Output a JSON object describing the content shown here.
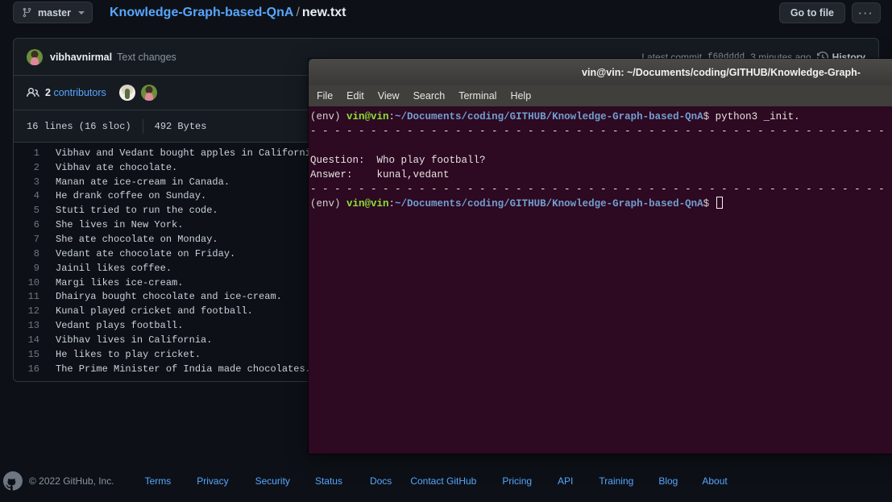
{
  "colors": {
    "page_bg": "#0d1117",
    "card_bg": "#161b22",
    "border": "#30363d",
    "link": "#58a6ff",
    "terminal_bg": "#2d0922",
    "terminal_green": "#8ae234",
    "terminal_blue": "#729fcf"
  },
  "header": {
    "branch_label": "master",
    "branch_icon": "git-branch-icon",
    "caret_icon": "chevron-down-icon",
    "repo_name": "Knowledge-Graph-based-QnA",
    "path_separator": "/",
    "file_name": "new.txt",
    "go_to_file_label": "Go to file",
    "more_options_label": "···"
  },
  "commit": {
    "author_avatar": "avatar-vibhavnirmal",
    "author": "vibhavnirmal",
    "message": "Text changes",
    "latest_commit_label": "Latest commit",
    "sha": "f60dddd",
    "time_ago": "3 minutes ago",
    "history_icon": "clock-icon",
    "history_label": "History"
  },
  "contributors": {
    "icon": "people-icon",
    "count": "2",
    "label": "contributors",
    "avatars": [
      "avatar-contributor-1",
      "avatar-contributor-2"
    ]
  },
  "file_stats": {
    "lines": "16 lines (16 sloc)",
    "size": "492 Bytes"
  },
  "file_content": {
    "lines": [
      "Vibhav and Vedant bought apples in California on Saturday.",
      "Vibhav ate chocolate.",
      "Manan ate ice-cream in Canada.",
      "He drank coffee on Sunday.",
      "Stuti tried to run the code.",
      "She lives in New York.",
      "She ate chocolate on Monday.",
      "Vedant ate chocolate on Friday.",
      "Jainil likes coffee.",
      "Margi likes ice-cream.",
      "Dhairya bought chocolate and ice-cream.",
      "Kunal played cricket and football.",
      "Vedant plays football.",
      "Vibhav lives in California.",
      "He likes to play cricket.",
      "The Prime Minister of India made chocolates."
    ],
    "line_numbers": [
      "1",
      "2",
      "3",
      "4",
      "5",
      "6",
      "7",
      "8",
      "9",
      "10",
      "11",
      "12",
      "13",
      "14",
      "15",
      "16"
    ]
  },
  "footer": {
    "logo": "github-mark-icon",
    "copyright": "© 2022 GitHub, Inc.",
    "links": [
      "Terms",
      "Privacy",
      "Security",
      "Status",
      "Docs",
      "Contact GitHub",
      "Pricing",
      "API",
      "Training",
      "Blog",
      "About"
    ]
  },
  "terminal": {
    "title": "vin@vin: ~/Documents/coding/GITHUB/Knowledge-Graph-",
    "menu": [
      "File",
      "Edit",
      "View",
      "Search",
      "Terminal",
      "Help"
    ],
    "lines": [
      {
        "type": "prompt",
        "env": "(env) ",
        "user": "vin@vin",
        "colon": ":",
        "path": "~/Documents/coding/GITHUB/Knowledge-Graph-based-QnA",
        "sigil": "$ ",
        "command": "python3 _init."
      },
      {
        "type": "rule",
        "text": "- - - - - - - - - - - - - - - - - - - - - - - - - - - - - - - - - - - - - - - - - - - - - - - - - - - - - - - - - - - -"
      },
      {
        "type": "text",
        "text": ""
      },
      {
        "type": "text",
        "text": "Question:  Who play football?"
      },
      {
        "type": "text",
        "text": "Answer:    kunal,vedant"
      },
      {
        "type": "rule",
        "text": "- - - - - - - - - - - - - - - - - - - - - - - - - - - - - - - - - - - - - - - - - - - - - - - - - - - - - - - - - - - -"
      },
      {
        "type": "prompt-cursor",
        "env": "(env) ",
        "user": "vin@vin",
        "colon": ":",
        "path": "~/Documents/coding/GITHUB/Knowledge-Graph-based-QnA",
        "sigil": "$ ",
        "command": ""
      }
    ]
  }
}
